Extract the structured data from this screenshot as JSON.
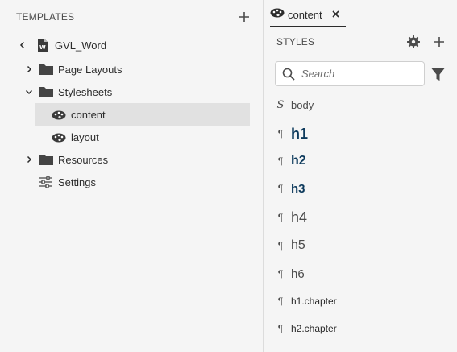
{
  "templates_panel": {
    "title": "TEMPLATES",
    "tree": {
      "root": {
        "label": "GVL_Word",
        "icon": "word-document-icon"
      },
      "items": [
        {
          "label": "Page Layouts",
          "icon": "folder-icon",
          "expanded": false
        },
        {
          "label": "Stylesheets",
          "icon": "folder-icon",
          "expanded": true
        },
        {
          "label": "content",
          "icon": "palette-icon",
          "selected": true
        },
        {
          "label": "layout",
          "icon": "palette-icon"
        },
        {
          "label": "Resources",
          "icon": "folder-icon",
          "expanded": false
        },
        {
          "label": "Settings",
          "icon": "sliders-icon"
        }
      ]
    }
  },
  "editor_tab": {
    "label": "content",
    "icon": "palette-icon"
  },
  "styles_panel": {
    "title": "STYLES",
    "search": {
      "placeholder": "Search",
      "value": ""
    },
    "items": [
      {
        "glyph": "S",
        "name": "body"
      },
      {
        "glyph": "¶",
        "name": "h1"
      },
      {
        "glyph": "¶",
        "name": "h2"
      },
      {
        "glyph": "¶",
        "name": "h3"
      },
      {
        "glyph": "¶",
        "name": "h4"
      },
      {
        "glyph": "¶",
        "name": "h5"
      },
      {
        "glyph": "¶",
        "name": "h6"
      },
      {
        "glyph": "¶",
        "name": "h1.chapter"
      },
      {
        "glyph": "¶",
        "name": "h2.chapter"
      }
    ]
  },
  "colors": {
    "heading_accent": "#0d3a5c",
    "selected_row": "#e1e1e1",
    "panel_bg": "#f5f5f5"
  }
}
